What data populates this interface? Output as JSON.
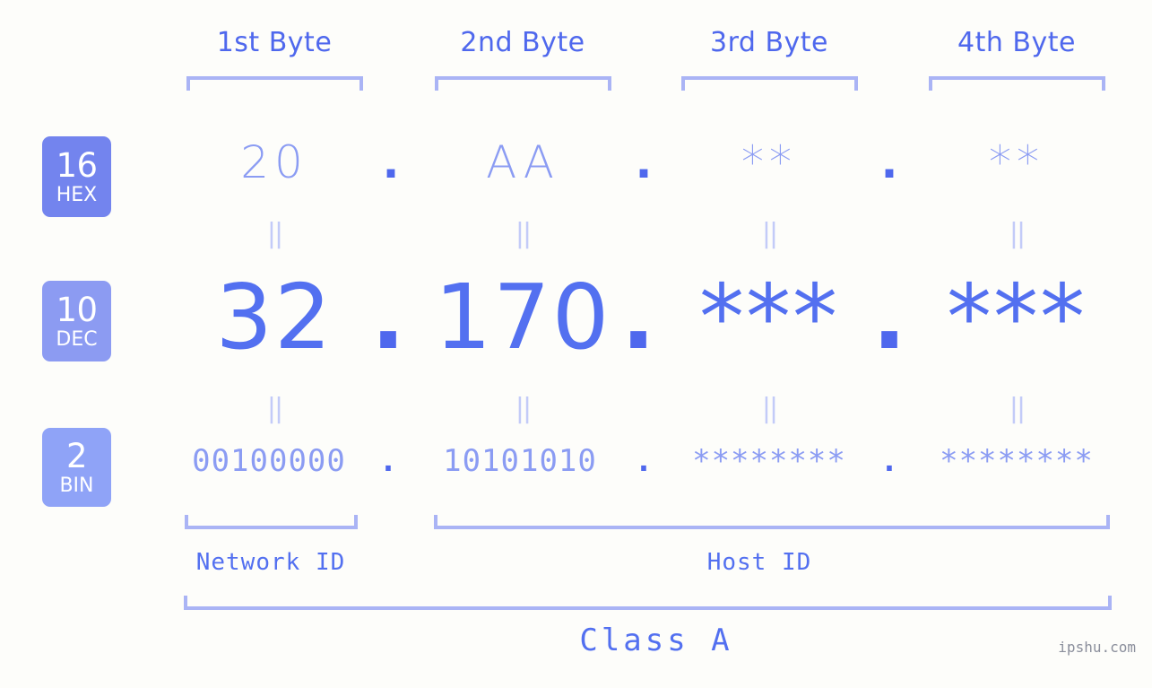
{
  "background_color": "#fdfdfa",
  "accent_colors": {
    "primary": "#4f68ed",
    "bright": "#5370f0",
    "muted": "#8b9cf3",
    "bracket": "#aab4f5",
    "separator": "#c3cbf8",
    "badge_hex": "#7384ee",
    "badge_dec": "#8c9bf2",
    "badge_bin": "#8fa3f7",
    "watermark": "#8b8f9c"
  },
  "byte_headers": [
    {
      "label": "1st Byte"
    },
    {
      "label": "2nd Byte"
    },
    {
      "label": "3rd Byte"
    },
    {
      "label": "4th Byte"
    }
  ],
  "rows": [
    {
      "badge_number": "16",
      "badge_name": "HEX",
      "values": [
        "20",
        "AA",
        "**",
        "**"
      ],
      "separators": [
        ".",
        ".",
        "."
      ]
    },
    {
      "badge_number": "10",
      "badge_name": "DEC",
      "values": [
        "32",
        "170",
        "***",
        "***"
      ],
      "separators": [
        ".",
        ".",
        "."
      ]
    },
    {
      "badge_number": "2",
      "badge_name": "BIN",
      "values": [
        "00100000",
        "10101010",
        "********",
        "********"
      ],
      "separators": [
        ".",
        ".",
        "."
      ]
    }
  ],
  "equality_marks": {
    "glyph": "||",
    "count_per_gap": 4
  },
  "bottom_captions": {
    "network_id": "Network ID",
    "host_id": "Host ID",
    "class": "Class A"
  },
  "watermark": "ipshu.com"
}
